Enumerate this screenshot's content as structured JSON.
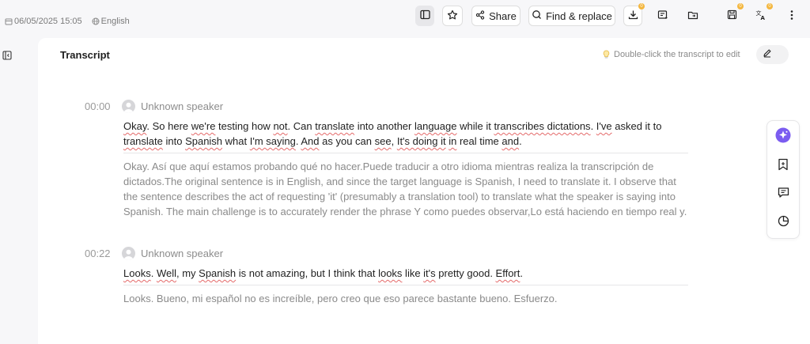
{
  "topbar": {
    "date": "06/05/2025 15:05",
    "language": "English",
    "share_label": "Share",
    "find_label": "Find & replace",
    "badge": "0"
  },
  "panel": {
    "title": "Transcript",
    "hint": "Double-click the transcript to edit"
  },
  "segments": [
    {
      "time": "00:00",
      "speaker": "Unknown speaker",
      "text_parts": [
        "Okay",
        ". So here ",
        "we're",
        " testing how ",
        "not",
        ". Can ",
        "translate",
        " into another ",
        "language",
        " while it ",
        "transcribes dictations",
        ". ",
        "I've",
        " asked it to ",
        "translate",
        " into ",
        "Spanish",
        " what ",
        "I'm saying",
        ". ",
        "And",
        " as you can ",
        "see",
        ", ",
        "It's doing it",
        " ",
        "in",
        " real time ",
        "and",
        "."
      ],
      "translation": "Okay. Así que aquí estamos probando qué no hacer.Puede traducir a otro idioma mientras realiza la transcripción de dictados.The original sentence is in English, and since the target language is Spanish, I need to translate it. I observe that the sentence describes the act of requesting 'it' (presumably a translation tool) to translate what the speaker is saying into Spanish. The main challenge is to accurately render the phrase Y como puedes observar,Lo está haciendo en tiempo real y."
    },
    {
      "time": "00:22",
      "speaker": "Unknown speaker",
      "text_parts": [
        "Looks",
        ". ",
        "Well",
        ", my ",
        "Spanish",
        " is not amazing, but I think that ",
        "looks",
        " like ",
        "it's",
        " pretty good. ",
        "Effort",
        "."
      ],
      "translation": "Looks. Bueno, mi español no es increíble, pero creo que eso parece bastante bueno. Esfuerzo."
    }
  ],
  "colors": {
    "accent": "#7b5cf0",
    "badge": "#f4b73f",
    "spellcheck": "#e46a6a"
  },
  "icons": [
    "calendar-icon",
    "globe-icon",
    "sidebar-toggle-icon",
    "star-icon",
    "share-icon",
    "find-replace-icon",
    "download-icon",
    "export-icon",
    "folder-icon",
    "save-icon",
    "translate-icon",
    "more-icon",
    "collapse-panel-icon",
    "lightbulb-icon",
    "pencil-icon",
    "ai-sparkle-icon",
    "bookmark-icon",
    "comment-icon",
    "chart-icon"
  ]
}
